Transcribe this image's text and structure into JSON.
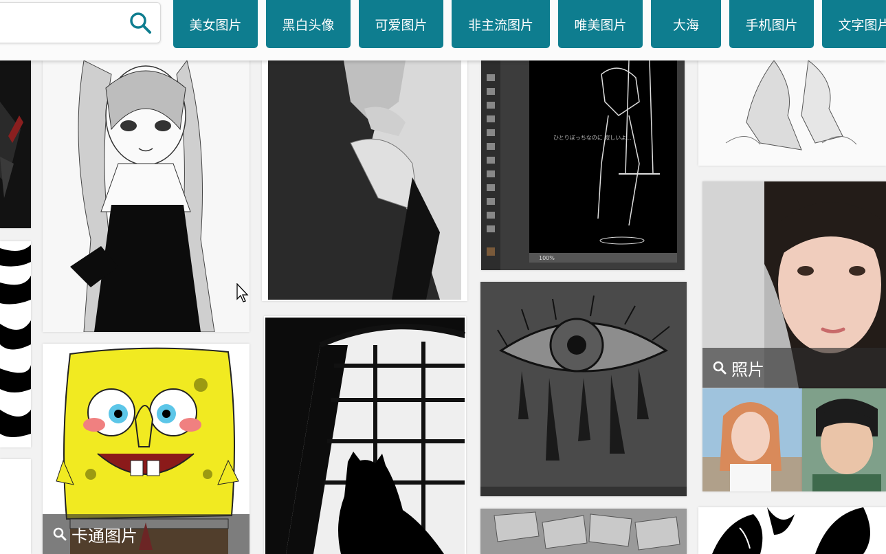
{
  "search": {
    "placeholder": "",
    "value": ""
  },
  "categories": [
    "美女图片",
    "黑白头像",
    "可爱图片",
    "非主流图片",
    "唯美图片",
    "大海",
    "手机图片",
    "文字图片"
  ],
  "tiles": {
    "cartoon_label": "卡通图片",
    "photo_label": "照片",
    "tutorial_caption": "ひとりぼっちなのに 寂しいよ...",
    "zoom_level": "100%"
  },
  "colors": {
    "accent": "#0e7d8f",
    "background": "#f2f2f2",
    "label_overlay": "#2d2d2d"
  },
  "icons": [
    "search-icon",
    "mouse-cursor-icon"
  ]
}
